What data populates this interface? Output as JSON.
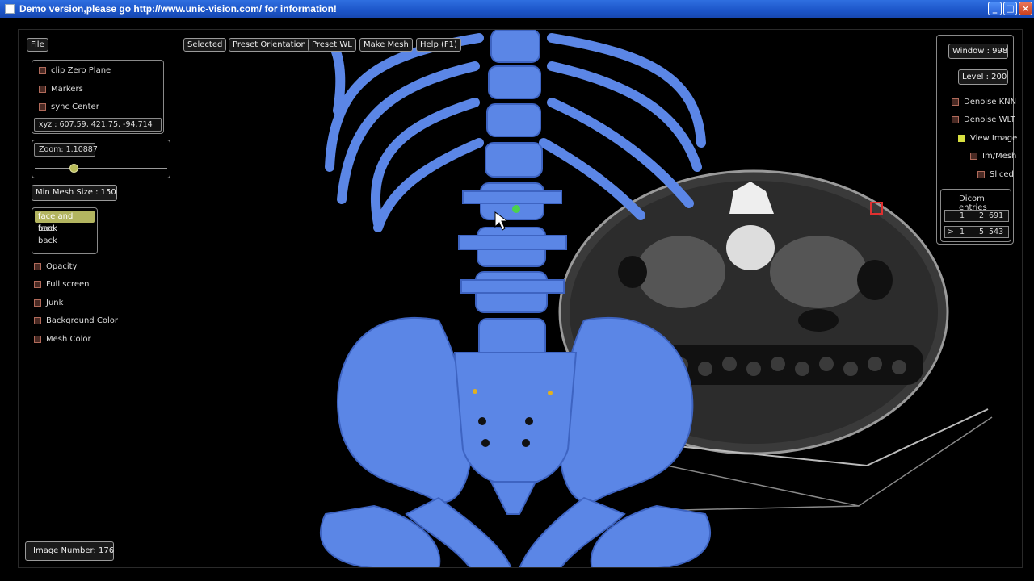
{
  "window": {
    "title": "Demo version,please go http://www.unic-vision.com/ for information!",
    "buttons": [
      "_",
      "□",
      "×"
    ]
  },
  "toolbar": {
    "file": "File",
    "selected": "Selected",
    "preset_orientation": "Preset Orientation",
    "preset_wl": "Preset WL",
    "make_mesh": "Make Mesh",
    "help": "Help (F1)"
  },
  "left_panel": {
    "checks": [
      {
        "label": "clip Zero Plane",
        "checked": false
      },
      {
        "label": "Markers",
        "checked": false
      },
      {
        "label": "sync Center",
        "checked": false
      }
    ],
    "xyz": "xyz  :   607.59,  421.75, -94.714",
    "zoom_label": "Zoom: 1.10887",
    "zoom_level": 0.3,
    "min_mesh": "Min Mesh Size : 150",
    "face_options": [
      "face and back",
      "face",
      "back"
    ],
    "face_selected": "face and back",
    "options": [
      "Opacity",
      "Full screen",
      "Junk",
      "Background Color",
      "Mesh Color"
    ],
    "image_number": "Image Number:  176"
  },
  "right_panel": {
    "window": "Window : 998",
    "level": "Level : 200",
    "checks": [
      {
        "label": "Denoise KNN",
        "checked": false
      },
      {
        "label": "Denoise WLT",
        "checked": false
      },
      {
        "label": "View Image",
        "checked": true
      },
      {
        "label": "Im/Mesh",
        "checked": false
      },
      {
        "label": "Sliced",
        "checked": false
      }
    ],
    "dicom_title": "Dicom entries",
    "dicom_rows": [
      {
        "marker": "",
        "a": "1",
        "b": "2",
        "c": "691"
      },
      {
        "marker": ">",
        "a": "1",
        "b": "5",
        "c": "543"
      }
    ]
  },
  "colors": {
    "bone": "#5b86e6",
    "bone_dark": "#3e64c2",
    "ct_slice": "#4a4a4a",
    "title_bar": "#1c55c8"
  }
}
